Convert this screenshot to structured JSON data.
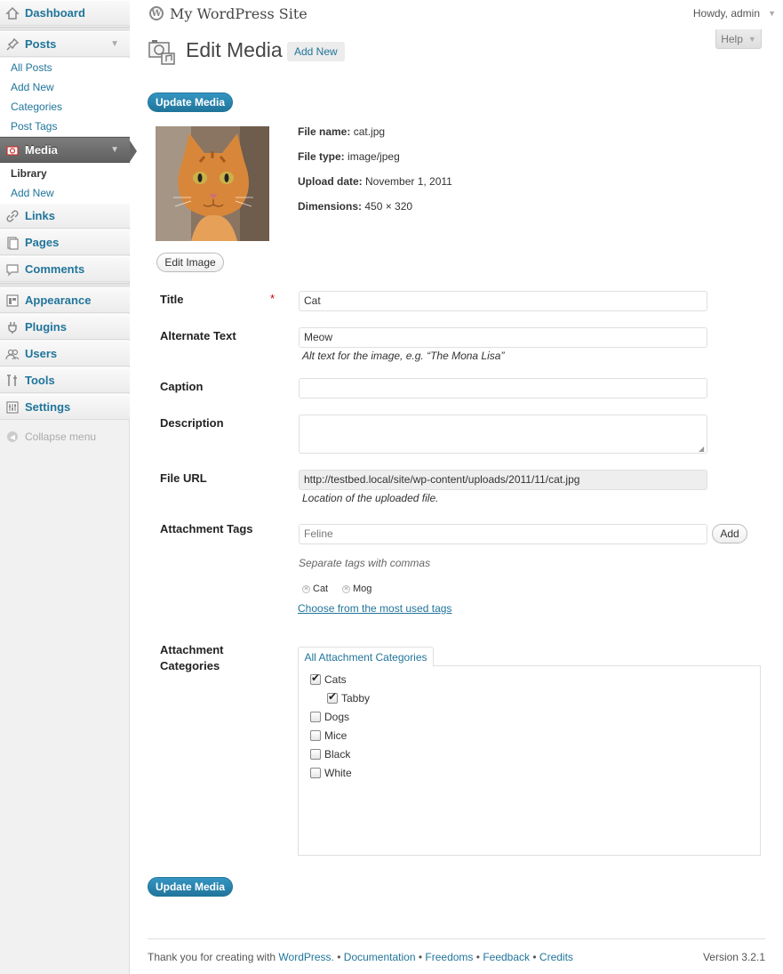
{
  "sidebar": {
    "dashboard": "Dashboard",
    "posts": "Posts",
    "posts_sub": [
      "All Posts",
      "Add New",
      "Categories",
      "Post Tags"
    ],
    "media": "Media",
    "media_sub": [
      "Library",
      "Add New"
    ],
    "links": "Links",
    "pages": "Pages",
    "comments": "Comments",
    "appearance": "Appearance",
    "plugins": "Plugins",
    "users": "Users",
    "tools": "Tools",
    "settings": "Settings",
    "collapse": "Collapse menu"
  },
  "header": {
    "site_title": "My WordPress Site",
    "howdy": "Howdy, admin",
    "help": "Help"
  },
  "page": {
    "title": "Edit Media",
    "add_new": "Add New",
    "update_button": "Update Media",
    "edit_image": "Edit Image"
  },
  "meta": {
    "file_name_label": "File name:",
    "file_name": "cat.jpg",
    "file_type_label": "File type:",
    "file_type": "image/jpeg",
    "upload_date_label": "Upload date:",
    "upload_date": "November 1, 2011",
    "dimensions_label": "Dimensions:",
    "dimensions": "450 × 320"
  },
  "form": {
    "title_label": "Title",
    "required_mark": "*",
    "title_value": "Cat",
    "alt_label": "Alternate Text",
    "alt_value": "Meow",
    "alt_hint": "Alt text for the image, e.g. “The Mona Lisa”",
    "caption_label": "Caption",
    "caption_value": "",
    "description_label": "Description",
    "description_value": "",
    "file_url_label": "File URL",
    "file_url_value": "http://testbed.local/site/wp-content/uploads/2011/11/cat.jpg",
    "file_url_hint": "Location of the uploaded file.",
    "tags_label": "Attachment Tags",
    "tags_placeholder": "Feline",
    "tags_add": "Add",
    "tags_hint": "Separate tags with commas",
    "tags": [
      "Cat",
      "Mog"
    ],
    "tags_most_used": "Choose from the most used tags",
    "categories_label_1": "Attachment",
    "categories_label_2": "Categories",
    "categories_tab": "All Attachment Categories",
    "categories": [
      {
        "name": "Cats",
        "checked": true
      },
      {
        "name": "Tabby",
        "checked": true
      },
      {
        "name": "Dogs",
        "checked": false
      },
      {
        "name": "Mice",
        "checked": false
      },
      {
        "name": "Black",
        "checked": false
      },
      {
        "name": "White",
        "checked": false
      }
    ]
  },
  "footer": {
    "thanks": "Thank you for creating with",
    "wordpress": "WordPress.",
    "sep": "•",
    "documentation": "Documentation",
    "freedoms": "Freedoms",
    "feedback": "Feedback",
    "credits": "Credits",
    "version": "Version 3.2.1"
  },
  "colors": {
    "link": "#21759b",
    "primary_button": "#21759b",
    "current_menu": "#6d6d6d"
  }
}
